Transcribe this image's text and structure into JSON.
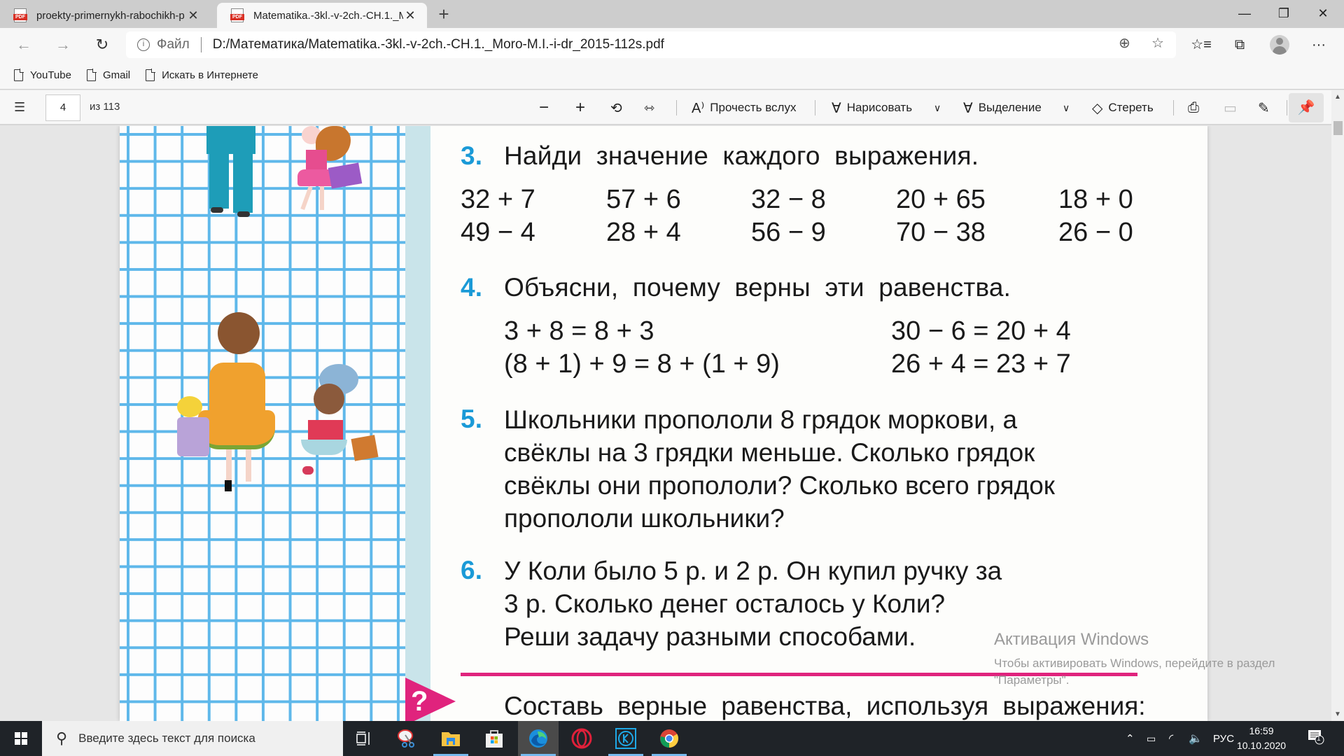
{
  "browser": {
    "tabs": [
      {
        "title": "proekty-primernykh-rabochikh-p",
        "icon": "pdf-icon",
        "active": false
      },
      {
        "title": "Matematika.-3kl.-v-2ch.-CH.1._M",
        "icon": "pdf-icon",
        "active": true
      }
    ],
    "new_tab_label": "+",
    "window_controls": {
      "minimize": "—",
      "restore": "❐",
      "close": "✕"
    },
    "address": {
      "scheme_label": "Файл",
      "url": "D:/Математика/Matematika.-3kl.-v-2ch.-CH.1._Moro-M.I.-i-dr_2015-112s.pdf"
    },
    "bookmarks": [
      {
        "label": "YouTube"
      },
      {
        "label": "Gmail"
      },
      {
        "label": "Искать в Интернете"
      }
    ]
  },
  "pdf_toolbar": {
    "current_page": "4",
    "page_count": "из 113",
    "read_aloud": "Прочесть вслух",
    "draw": "Нарисовать",
    "highlight": "Выделение",
    "erase": "Стереть"
  },
  "document": {
    "task3": {
      "number": "3.",
      "title": "Найди значение каждого выражения.",
      "expressions": [
        [
          "32 + 7",
          "57 + 6",
          "32 − 8",
          "20 + 65",
          "18 + 0"
        ],
        [
          "49 − 4",
          "28 + 4",
          "56 − 9",
          "70 − 38",
          "26 − 0"
        ]
      ]
    },
    "task4": {
      "number": "4.",
      "title": "Объясни, почему верны эти равенства.",
      "equalities_left": [
        "3 + 8 = 8 + 3",
        "(8 + 1) + 9 = 8 + (1 + 9)"
      ],
      "equalities_right": [
        "30 − 6 = 20 + 4",
        "26 + 4 = 23 + 7"
      ]
    },
    "task5": {
      "number": "5.",
      "lines": [
        "Школьники пропололи 8 грядок моркови, а",
        "свёклы на 3 грядки меньше. Сколько грядок",
        "свёклы они пропололи? Сколько всего грядок",
        "пропололи школьники?"
      ]
    },
    "task6": {
      "number": "6.",
      "lines": [
        "У Коли было 5 р. и 2 р. Он купил ручку за",
        "3 р. Сколько денег осталось у Коли?",
        "Реши задачу разными способами."
      ]
    },
    "bonus": {
      "marker": "?",
      "text": "Составь верные равенства, используя выражения:"
    },
    "colors": {
      "task_number": "#1a9ad7",
      "divider": "#e0237d",
      "grid": "#5fb8ea"
    }
  },
  "watermark": {
    "title": "Активация Windows",
    "subtitle": "Чтобы активировать Windows, перейдите в раздел \"Параметры\"."
  },
  "taskbar": {
    "search_placeholder": "Введите здесь текст для поиска",
    "apps": [
      "task-view",
      "snipping-tool",
      "file-explorer",
      "microsoft-store",
      "edge",
      "opera",
      "k-app",
      "chrome"
    ],
    "language": "РУС",
    "time": "16:59",
    "date": "10.10.2020",
    "notification_count": "1"
  }
}
